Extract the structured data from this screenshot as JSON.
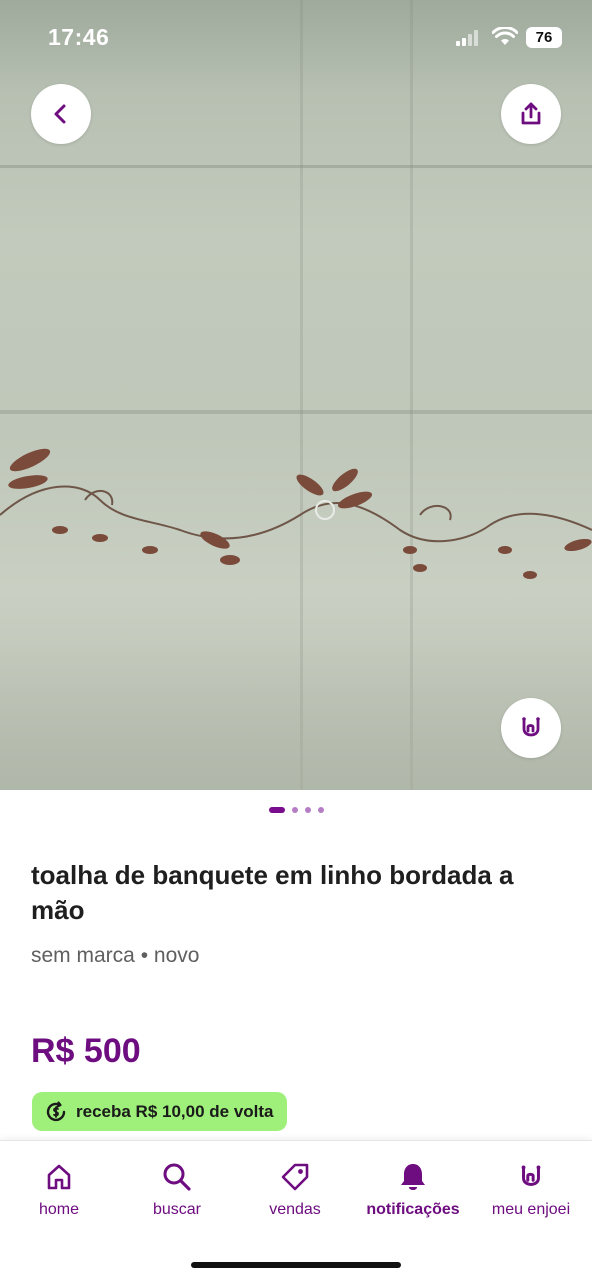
{
  "status_bar": {
    "time": "17:46",
    "battery": "76"
  },
  "gallery": {
    "photo_count": 4,
    "active_index": 0
  },
  "header": {
    "back_icon": "chevron-left-icon",
    "share_icon": "share-icon",
    "like_icon": "rock-hand-icon"
  },
  "product": {
    "title": "toalha de banquete em linho bordada a mão",
    "brand": "sem marca",
    "separator": "•",
    "condition": "novo",
    "price": "R$ 500",
    "cashback": "receba R$ 10,00 de volta"
  },
  "tabs": [
    {
      "label": "home",
      "icon": "home-icon",
      "active": false
    },
    {
      "label": "buscar",
      "icon": "search-icon",
      "active": false
    },
    {
      "label": "vendas",
      "icon": "tag-icon",
      "active": false
    },
    {
      "label": "notificações",
      "icon": "bell-icon",
      "active": true
    },
    {
      "label": "meu enjoei",
      "icon": "rock-hand-icon",
      "active": false
    }
  ],
  "colors": {
    "brand": "#6e0d80",
    "cashback_bg": "#9ef07a",
    "pager_inactive": "#b47dc4"
  }
}
